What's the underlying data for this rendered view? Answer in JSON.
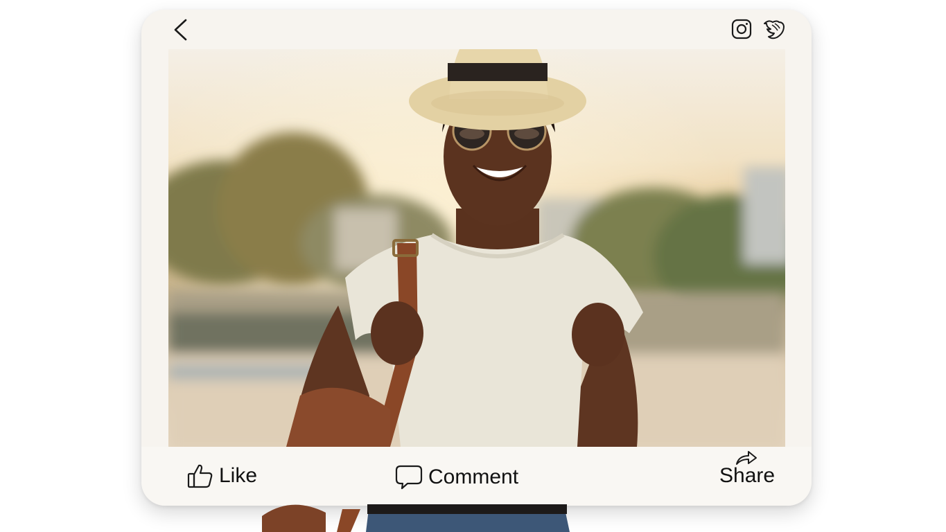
{
  "post": {
    "actions": {
      "like_label": "Like",
      "comment_label": "Comment",
      "share_label": "Share"
    }
  },
  "icons": {
    "back": "chevron-left-icon",
    "camera": "instagram-camera-icon",
    "bird": "bird-icon",
    "like": "thumbs-up-icon",
    "comment": "speech-bubble-icon",
    "share": "share-arrow-icon"
  },
  "colors": {
    "card_background": "#f7f4ef",
    "text": "#111111",
    "icon_stroke": "#1a1a1a"
  }
}
